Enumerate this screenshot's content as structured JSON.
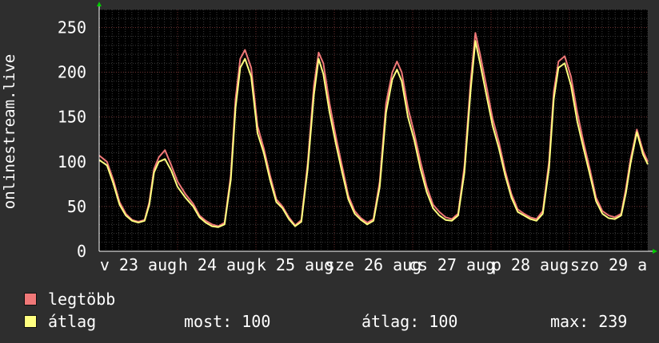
{
  "chart_data": {
    "type": "line",
    "ylabel": "onlinestream.live",
    "ylim": [
      0,
      270
    ],
    "yticks": [
      0,
      50,
      100,
      150,
      200,
      250
    ],
    "xlim": [
      0,
      7.0
    ],
    "xticks": [
      {
        "label": "v 23 aug",
        "x": 0.5
      },
      {
        "label": "h 24 aug",
        "x": 1.5
      },
      {
        "label": "k 25 aug",
        "x": 2.5
      },
      {
        "label": "sze 26 aug",
        "x": 3.5
      },
      {
        "label": "cs 27 aug",
        "x": 4.5
      },
      {
        "label": "p 28 aug",
        "x": 5.5
      },
      {
        "label": "szo 29 a",
        "x": 6.5
      }
    ],
    "grid": true,
    "series": [
      {
        "name": "legtöbb",
        "color": "#f07878",
        "x": [
          0.0,
          0.1,
          0.18,
          0.26,
          0.34,
          0.42,
          0.5,
          0.58,
          0.64,
          0.7,
          0.76,
          0.84,
          0.92,
          1.0,
          1.1,
          1.2,
          1.28,
          1.36,
          1.44,
          1.52,
          1.6,
          1.68,
          1.74,
          1.8,
          1.86,
          1.94,
          2.02,
          2.1,
          2.18,
          2.26,
          2.34,
          2.42,
          2.5,
          2.58,
          2.66,
          2.74,
          2.8,
          2.86,
          2.94,
          3.02,
          3.1,
          3.18,
          3.26,
          3.34,
          3.42,
          3.5,
          3.58,
          3.66,
          3.74,
          3.8,
          3.86,
          3.94,
          4.02,
          4.1,
          4.18,
          4.26,
          4.34,
          4.42,
          4.5,
          4.58,
          4.66,
          4.74,
          4.8,
          4.86,
          4.94,
          5.02,
          5.1,
          5.18,
          5.26,
          5.34,
          5.42,
          5.5,
          5.58,
          5.66,
          5.74,
          5.8,
          5.86,
          5.94,
          6.02,
          6.1,
          6.18,
          6.26,
          6.34,
          6.42,
          6.5,
          6.58,
          6.66,
          6.72,
          6.78,
          6.86,
          6.94,
          7.0
        ],
        "values": [
          107,
          100,
          80,
          55,
          42,
          35,
          33,
          35,
          55,
          92,
          105,
          113,
          96,
          78,
          64,
          53,
          40,
          34,
          30,
          28,
          32,
          85,
          170,
          215,
          225,
          205,
          140,
          115,
          85,
          58,
          50,
          38,
          29,
          35,
          98,
          185,
          222,
          210,
          165,
          128,
          95,
          62,
          45,
          37,
          32,
          36,
          78,
          165,
          200,
          212,
          200,
          160,
          132,
          100,
          72,
          52,
          44,
          38,
          36,
          42,
          95,
          190,
          244,
          220,
          185,
          148,
          122,
          90,
          64,
          47,
          42,
          38,
          36,
          45,
          100,
          178,
          212,
          218,
          195,
          155,
          122,
          92,
          60,
          45,
          40,
          38,
          42,
          70,
          103,
          136,
          112,
          100
        ]
      },
      {
        "name": "átlag",
        "color": "#ffff80",
        "x": [
          0.0,
          0.1,
          0.18,
          0.26,
          0.34,
          0.42,
          0.5,
          0.58,
          0.64,
          0.7,
          0.76,
          0.84,
          0.92,
          1.0,
          1.1,
          1.2,
          1.28,
          1.36,
          1.44,
          1.52,
          1.6,
          1.68,
          1.74,
          1.8,
          1.86,
          1.94,
          2.02,
          2.1,
          2.18,
          2.26,
          2.34,
          2.42,
          2.5,
          2.58,
          2.66,
          2.74,
          2.8,
          2.86,
          2.94,
          3.02,
          3.1,
          3.18,
          3.26,
          3.34,
          3.42,
          3.5,
          3.58,
          3.66,
          3.74,
          3.8,
          3.86,
          3.94,
          4.02,
          4.1,
          4.18,
          4.26,
          4.34,
          4.42,
          4.5,
          4.58,
          4.66,
          4.74,
          4.8,
          4.86,
          4.94,
          5.02,
          5.1,
          5.18,
          5.26,
          5.34,
          5.42,
          5.5,
          5.58,
          5.66,
          5.74,
          5.8,
          5.86,
          5.94,
          6.02,
          6.1,
          6.18,
          6.26,
          6.34,
          6.42,
          6.5,
          6.58,
          6.66,
          6.72,
          6.78,
          6.86,
          6.94,
          7.0
        ],
        "values": [
          102,
          96,
          76,
          52,
          40,
          34,
          32,
          34,
          52,
          88,
          100,
          103,
          90,
          72,
          60,
          50,
          38,
          32,
          28,
          27,
          30,
          80,
          160,
          205,
          215,
          195,
          132,
          110,
          80,
          55,
          48,
          36,
          28,
          33,
          92,
          175,
          215,
          198,
          155,
          120,
          88,
          58,
          42,
          35,
          30,
          34,
          72,
          155,
          192,
          203,
          190,
          150,
          124,
          92,
          66,
          48,
          40,
          35,
          34,
          40,
          88,
          180,
          235,
          210,
          175,
          140,
          115,
          85,
          60,
          44,
          40,
          36,
          34,
          42,
          93,
          170,
          205,
          210,
          185,
          145,
          115,
          86,
          56,
          42,
          37,
          36,
          40,
          65,
          98,
          133,
          108,
          97
        ]
      }
    ]
  },
  "legend": {
    "max_label": "legtöbb",
    "avg_label": "átlag",
    "now_text": "most: 100",
    "avg_text": "átlag: 100",
    "max_text": "max: 239"
  },
  "colors": {
    "background": "#2e2e2e",
    "plot_background": "#000000",
    "grid_major": "#6a2f2f",
    "grid_minor": "#3a3a3a",
    "axis": "#ffffff",
    "arrow": "#00cc00"
  }
}
